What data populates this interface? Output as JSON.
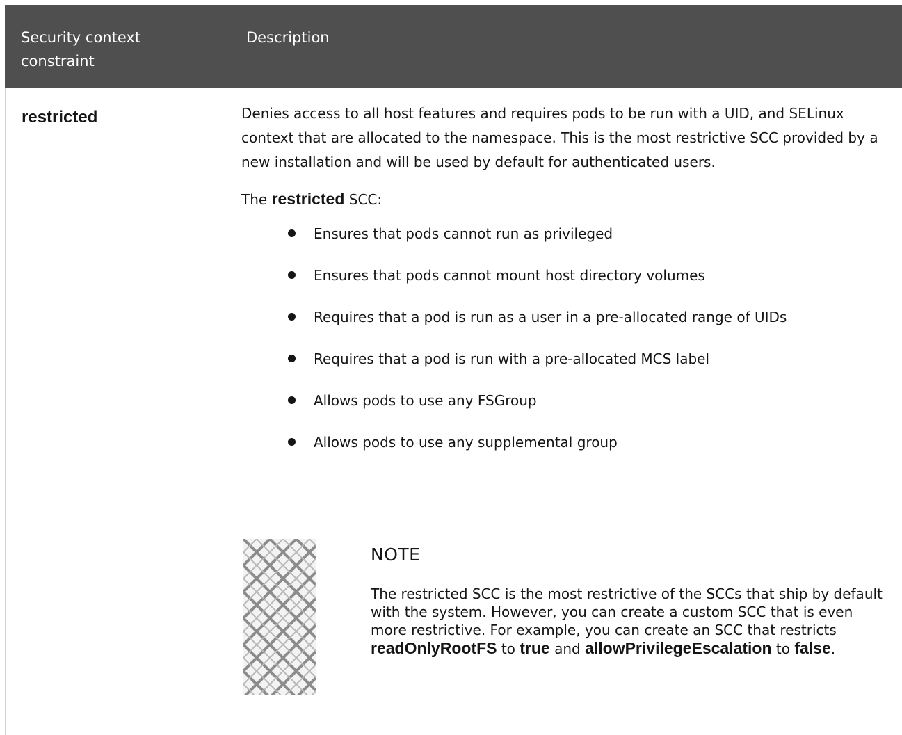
{
  "table": {
    "headers": [
      "Security context constraint",
      "Description"
    ],
    "row": {
      "name": "restricted",
      "description": "Denies access to all host features and requires pods to be run with a UID, and SELinux context that are allocated to the namespace. This is the most restrictive SCC provided by a new installation and will be used by default for authenticated users.",
      "intro_prefix": "The",
      "intro_bold": "restricted",
      "intro_suffix": "SCC:",
      "bullets": [
        "Ensures that pods cannot run as privileged",
        "Ensures that pods cannot mount host directory volumes",
        "Requires that a pod is run as a user in a pre-allocated range of UIDs",
        "Requires that a pod is run with a pre-allocated MCS label",
        "Allows pods to use any FSGroup",
        "Allows pods to use any supplemental group"
      ],
      "note": {
        "icon": "note-pattern-icon",
        "title": "NOTE",
        "text_1": "The restricted SCC is the most restrictive of the SCCs that ship by default with the system. However, you can create a custom SCC that is even more restrictive. For example, you can create an SCC that restricts",
        "bold_1": "readOnlyRootFS",
        "text_2": "to",
        "bold_2": "true",
        "text_3": "and",
        "bold_3": "allowPrivilegeEscalation",
        "text_4": "to",
        "bold_4": "false",
        "text_5": "."
      }
    }
  },
  "colors": {
    "header_bg": "#4f4f4f",
    "header_text": "#ffffff",
    "body_text": "#151515",
    "border": "#d2d2d2"
  }
}
